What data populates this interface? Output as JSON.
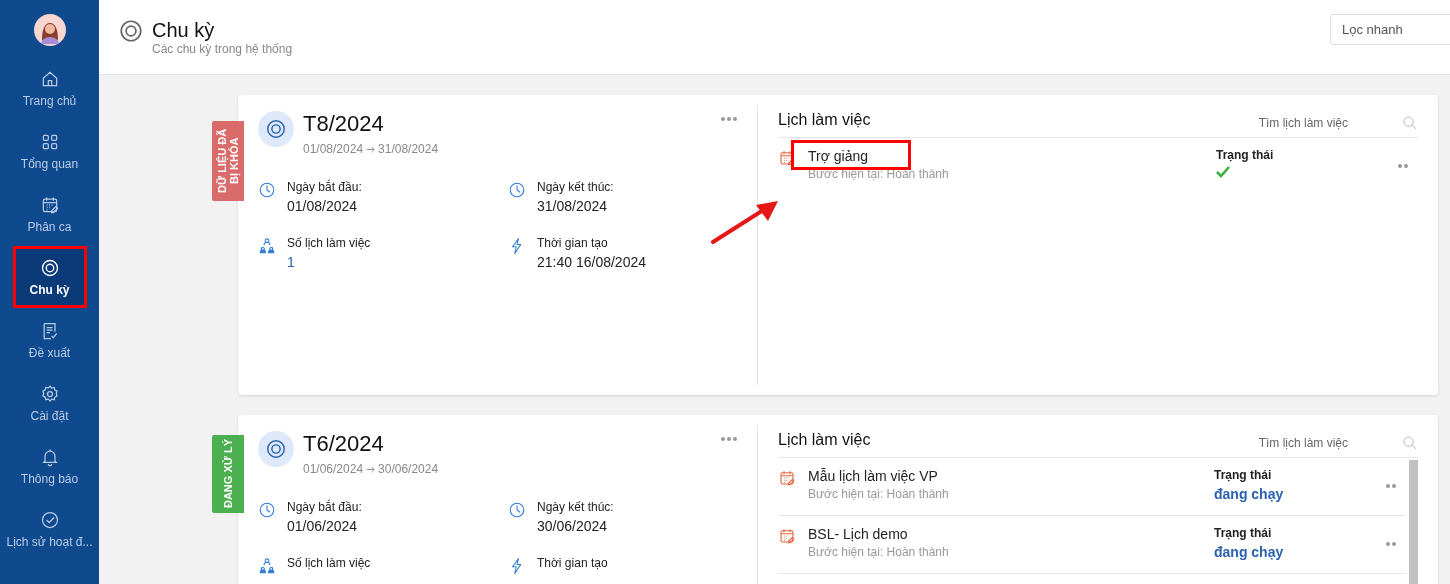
{
  "sidebar": {
    "items": [
      {
        "label": "Trang chủ",
        "selected": false,
        "highlighted": false
      },
      {
        "label": "Tổng quan",
        "selected": false,
        "highlighted": false
      },
      {
        "label": "Phân ca",
        "selected": false,
        "highlighted": false
      },
      {
        "label": "Chu kỳ",
        "selected": true,
        "highlighted": true
      },
      {
        "label": "Đề xuất",
        "selected": false,
        "highlighted": false
      },
      {
        "label": "Cài đặt",
        "selected": false,
        "highlighted": false
      },
      {
        "label": "Thông báo",
        "selected": false,
        "highlighted": false
      },
      {
        "label": "Lịch sử hoạt đ...",
        "selected": false,
        "highlighted": false
      }
    ]
  },
  "header": {
    "title": "Chu kỳ",
    "subtitle": "Các chu kỳ trong hệ thống",
    "filter": {
      "placeholder": "Lọc nhanh"
    }
  },
  "cycles": [
    {
      "status_tag": "DỮ LIỆU ĐÃ BỊ KHÓA",
      "color": "#d96b6b",
      "title": "T8/2024",
      "range_start": "01/08/2024",
      "range_end": "31/08/2024",
      "fields": [
        {
          "label": "Ngày bắt đầu:",
          "value": "01/08/2024"
        },
        {
          "label": "Ngày kết thúc:",
          "value": "31/08/2024"
        },
        {
          "label": "Số lịch làm việc",
          "value": "1"
        },
        {
          "label": "Thời gian tạo",
          "value": "21:40 16/08/2024"
        }
      ],
      "schedules": {
        "title": "Lịch làm việc",
        "search_placeholder": "Tìm lịch làm việc",
        "annotation_arrow": true,
        "items": [
          {
            "name": "Trợ giảng",
            "step": "Bước hiện tại: Hoàn thành",
            "status_label": "Trạng thái",
            "status": {
              "kind": "check"
            },
            "highlighted": true
          }
        ]
      }
    },
    {
      "status_tag": "ĐANG XỬ LÝ",
      "color": "#4caf50",
      "title": "T6/2024",
      "range_start": "01/06/2024",
      "range_end": "30/06/2024",
      "fields": [
        {
          "label": "Ngày bắt đầu:",
          "value": "01/06/2024"
        },
        {
          "label": "Ngày kết thúc:",
          "value": "30/06/2024"
        },
        {
          "label": "Số lịch làm việc"
        },
        {
          "label": "Thời gian tạo"
        }
      ],
      "schedules": {
        "title": "Lịch làm việc",
        "search_placeholder": "Tìm lịch làm việc",
        "items": [
          {
            "name": "Mẫu lịch làm việc VP",
            "step": "Bước hiện tại: Hoàn thành",
            "status_label": "Trạng thái",
            "status": {
              "kind": "text",
              "text": "đang chạy"
            },
            "highlighted": false
          },
          {
            "name": "BSL- Lịch demo",
            "step": "Bước hiện tại: Hoàn thành",
            "status_label": "Trạng thái",
            "status": {
              "kind": "text",
              "text": "đang chạy"
            },
            "highlighted": false
          }
        ]
      }
    }
  ]
}
